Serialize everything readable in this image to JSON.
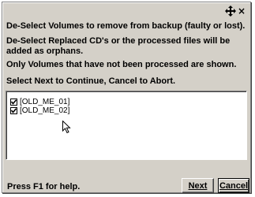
{
  "dialog": {
    "title_icons": [
      "move-icon",
      "close-icon"
    ],
    "close_glyph": "×",
    "messages": [
      "De-Select Volumes to remove from backup (faulty or lost).",
      "De-Select Replaced CD's or the processed files will be added as orphans.",
      "Only Volumes that have not been processed are shown.",
      "Select Next to Continue, Cancel to Abort."
    ],
    "volumes": [
      {
        "label": "[OLD_ME_01]",
        "checked": true
      },
      {
        "label": "[OLD_ME_02]",
        "checked": true
      }
    ],
    "help_text": "Press F1 for help.",
    "next_label": "Next",
    "cancel_label": "Cancel"
  }
}
